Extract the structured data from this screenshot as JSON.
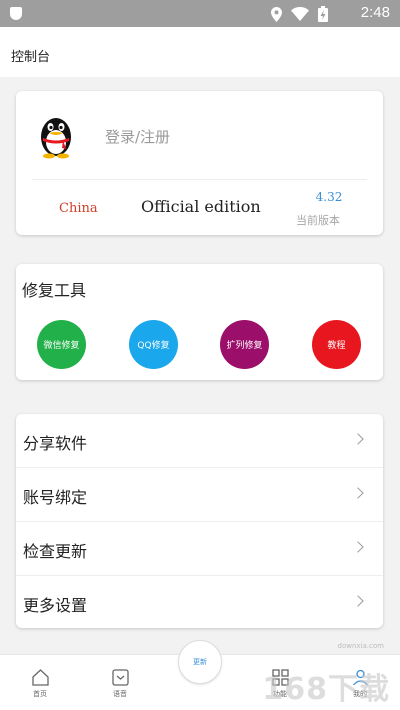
{
  "status": {
    "time": "2:48"
  },
  "appbar": {
    "title": "控制台"
  },
  "login": {
    "text": "登录/注册",
    "region": "China",
    "edition": "Official edition",
    "version": "4.32",
    "version_label": "当前版本"
  },
  "tools": {
    "title": "修复工具",
    "items": [
      {
        "label": "微信修复",
        "color": "#21b04a"
      },
      {
        "label": "QQ修复",
        "color": "#1aa7ec"
      },
      {
        "label": "扩列修复",
        "color": "#9b0f6b"
      },
      {
        "label": "教程",
        "color": "#e8171f"
      }
    ]
  },
  "menu": {
    "items": [
      {
        "label": "分享软件"
      },
      {
        "label": "账号绑定"
      },
      {
        "label": "检查更新"
      },
      {
        "label": "更多设置"
      }
    ]
  },
  "bottom_nav": {
    "items": [
      {
        "label": "首页",
        "icon": "home-icon"
      },
      {
        "label": "语音",
        "icon": "voice-icon"
      },
      {
        "label": "功能",
        "icon": "grid-icon"
      },
      {
        "label": "我的",
        "icon": "user-icon"
      }
    ],
    "fab_label": "更新"
  },
  "watermark": {
    "text": "168下载",
    "url": "downxia.com"
  },
  "colors": {
    "accent": "#3a8fd8",
    "region_red": "#d0402a"
  }
}
